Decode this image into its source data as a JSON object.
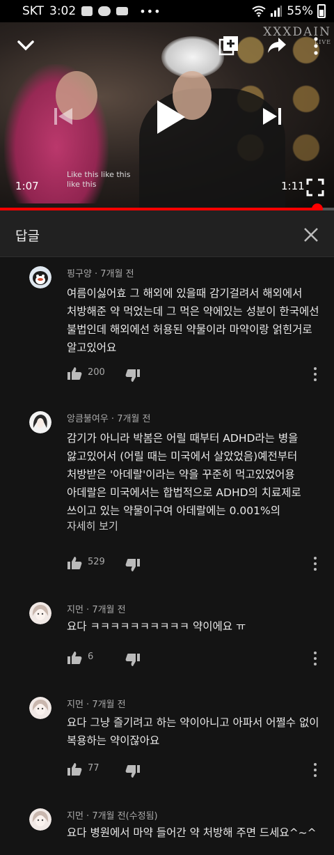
{
  "status_bar": {
    "carrier": "SKT",
    "time": "3:02",
    "battery": "55%"
  },
  "video": {
    "current_time": "1:07",
    "duration": "1:11",
    "progress_fraction": 0.95,
    "watermark": "XXXDAIN",
    "watermark_sub": "LIVE",
    "subtitle_line1": "Like this like this",
    "subtitle_line2": "like this"
  },
  "replies": {
    "title": "답글"
  },
  "comments": [
    {
      "author_meta": "핑구양 · 7개월 전",
      "text": "여름이싫어효 그 해외에 있을때 감기걸려서 해외에서\n처방해준 약 먹었는데 그 먹은 약에있는 성분이 한국에선\n불법인데 해외에선 허용된 약물이라 마약이랑 얽힌거로\n알고있어요",
      "likes": "200",
      "read_more": ""
    },
    {
      "author_meta": "앙큼불여우 · 7개월 전",
      "text": "감기가 아니라 박봄은 어릴 때부터 ADHD라는 병을\n앓고있어서 (어릴 때는 미국에서 살았었음)예전부터\n처방받은 '아데랄'이라는 약을 꾸준히 먹고있었어용\n아데랄은 미국에서는 합법적으로 ADHD의 치료제로\n쓰이고 있는 약물이구여 아데랄에는 0.001%의",
      "likes": "529",
      "read_more": "자세히 보기"
    },
    {
      "author_meta": "지먼 · 7개월 전",
      "text": "요다 ㅋㅋㅋㅋㅋㅋㅋㅋㅋㅋ 약이에요 ㅠ",
      "likes": "6",
      "read_more": ""
    },
    {
      "author_meta": "지먼 · 7개월 전",
      "text": "요다 그냥 즐기려고 하는 약이아니고 아파서 어쩔수 없이\n복용하는 약이잖아요",
      "likes": "77",
      "read_more": ""
    },
    {
      "author_meta": "지먼 · 7개월 전(수정됨)",
      "text": "요다 병원에서 마약 들어간 약 처방해 주면 드세요^~^",
      "likes": "",
      "read_more": ""
    }
  ],
  "colors": {
    "progress": "#ff0000",
    "background": "#141414",
    "header": "#212121"
  }
}
